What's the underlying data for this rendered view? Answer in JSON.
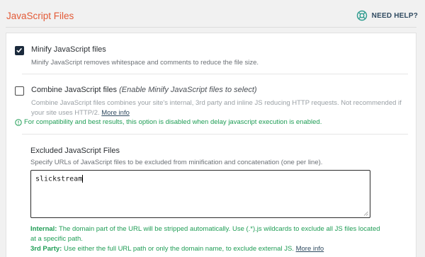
{
  "header": {
    "title": "JavaScript Files",
    "help_label": "NEED HELP?"
  },
  "minify": {
    "checked": true,
    "label": "Minify JavaScript files",
    "description": "Minify JavaScript removes whitespace and comments to reduce the file size."
  },
  "combine": {
    "checked": false,
    "label": "Combine JavaScript files",
    "label_note": "(Enable Minify JavaScript files to select)",
    "description": "Combine JavaScript files combines your site's internal, 3rd party and inline JS reducing HTTP requests. Not recommended if your site uses HTTP/2.",
    "more_info": "More info"
  },
  "notice": {
    "text": "For compatibility and best results, this option is disabled when delay javascript execution is enabled."
  },
  "excluded": {
    "title": "Excluded JavaScript Files",
    "description": "Specify URLs of JavaScript files to be excluded from minification and concatenation (one per line).",
    "value": "slickstream"
  },
  "footnote": {
    "internal_label": "Internal:",
    "internal_text": "The domain part of the URL will be stripped automatically. Use (.*).js wildcards to exclude all JS files located at a specific path.",
    "third_party_label": "3rd Party:",
    "third_party_text": "Use either the full URL path or only the domain name, to exclude external JS.",
    "more_info": "More info"
  },
  "colors": {
    "accent": "#e35a37",
    "success": "#1f9d55",
    "checkbox_checked": "#1b2a3c"
  },
  "icons": {
    "help": "lifebuoy-icon",
    "notice": "info-circle-icon",
    "checkmark": "checkmark-icon"
  }
}
